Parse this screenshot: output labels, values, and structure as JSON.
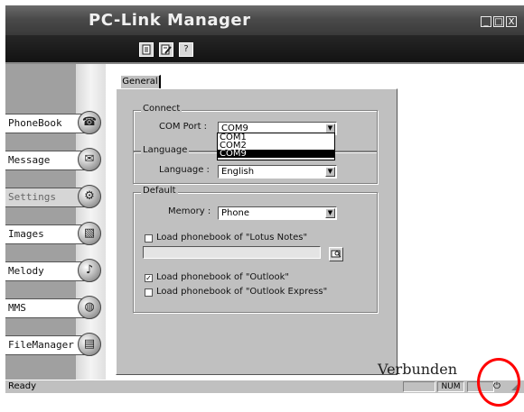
{
  "window": {
    "title": "PC-Link Manager",
    "controls": [
      "_",
      "□",
      "X"
    ]
  },
  "toolbar": {
    "buttons": [
      {
        "icon": "document-icon"
      },
      {
        "icon": "edit-document-icon"
      },
      {
        "icon": "help-icon",
        "glyph": "?"
      }
    ]
  },
  "sidebar": {
    "items": [
      {
        "label": "PhoneBook",
        "icon": "mobile-phone-icon",
        "glyph": "☎"
      },
      {
        "label": "Message",
        "icon": "envelope-icon",
        "glyph": "✉"
      },
      {
        "label": "Settings",
        "icon": "gear-icon",
        "glyph": "⚙"
      },
      {
        "label": "Images",
        "icon": "image-icon",
        "glyph": "▧"
      },
      {
        "label": "Melody",
        "icon": "music-note-icon",
        "glyph": "♪"
      },
      {
        "label": "MMS",
        "icon": "globe-icon",
        "glyph": "◍"
      },
      {
        "label": "FileManager",
        "icon": "filing-box-icon",
        "glyph": "▤"
      }
    ],
    "active": "Settings"
  },
  "tab": {
    "label": "General"
  },
  "connect": {
    "legend": "Connect",
    "com_label": "COM Port :",
    "com_value": "COM9",
    "options": [
      "COM1",
      "COM2",
      "COM9"
    ],
    "selected_option": "COM9"
  },
  "language": {
    "legend": "Language",
    "label": "Language :",
    "value": "English"
  },
  "default": {
    "legend": "Default",
    "memory_label": "Memory :",
    "memory_value": "Phone",
    "lotus_label": "Load phonebook of \"Lotus Notes\"",
    "lotus_checked": false,
    "lotus_path": "",
    "outlook_label": "Load phonebook of \"Outlook\"",
    "outlook_checked": true,
    "outlook_express_label": "Load phonebook of \"Outlook Express\"",
    "outlook_express_checked": false
  },
  "status": {
    "text": "Ready",
    "num": "NUM",
    "connection": "Verbunden"
  },
  "colors": {
    "annotation_circle": "#ff0000"
  }
}
